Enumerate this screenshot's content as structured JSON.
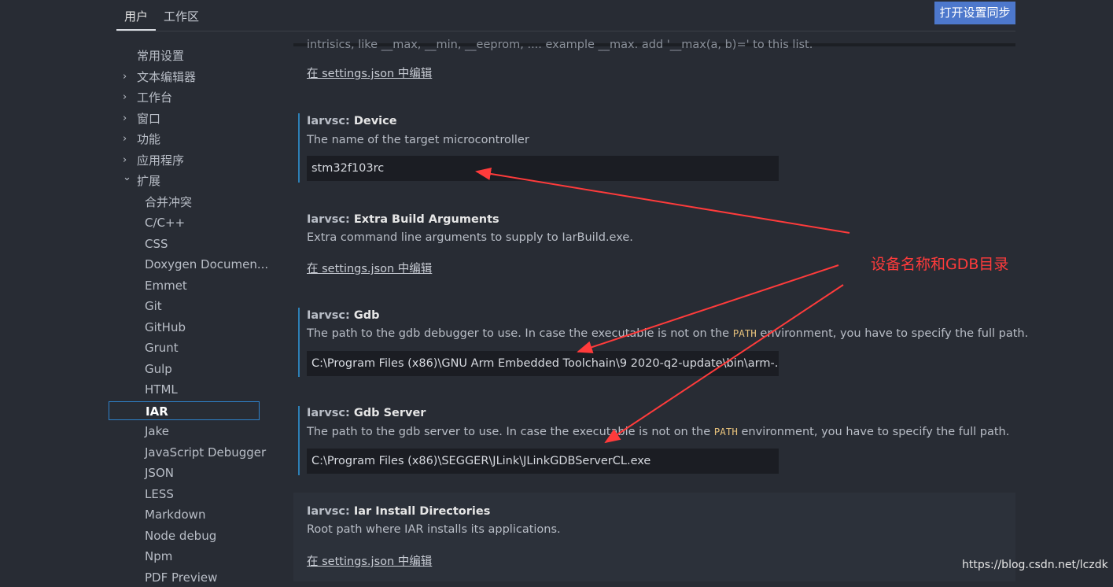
{
  "tabs": [
    {
      "label": "用户",
      "active": true
    },
    {
      "label": "工作区",
      "active": false
    }
  ],
  "sync_button": "打开设置同步",
  "sidebar": {
    "items": [
      {
        "label": "常用设置",
        "chevron": ""
      },
      {
        "label": "文本编辑器",
        "chevron": "›"
      },
      {
        "label": "工作台",
        "chevron": "›"
      },
      {
        "label": "窗口",
        "chevron": "›"
      },
      {
        "label": "功能",
        "chevron": "›"
      },
      {
        "label": "应用程序",
        "chevron": "›"
      },
      {
        "label": "扩展",
        "chevron": "⌄"
      },
      {
        "label": "合并冲突",
        "chevron": ""
      },
      {
        "label": "C/C++",
        "chevron": ""
      },
      {
        "label": "CSS",
        "chevron": ""
      },
      {
        "label": "Doxygen Documen...",
        "chevron": ""
      },
      {
        "label": "Emmet",
        "chevron": ""
      },
      {
        "label": "Git",
        "chevron": ""
      },
      {
        "label": "GitHub",
        "chevron": ""
      },
      {
        "label": "Grunt",
        "chevron": ""
      },
      {
        "label": "Gulp",
        "chevron": ""
      },
      {
        "label": "HTML",
        "chevron": ""
      },
      {
        "label": "IAR",
        "chevron": "",
        "selected": true
      },
      {
        "label": "Jake",
        "chevron": ""
      },
      {
        "label": "JavaScript Debugger",
        "chevron": ""
      },
      {
        "label": "JSON",
        "chevron": ""
      },
      {
        "label": "LESS",
        "chevron": ""
      },
      {
        "label": "Markdown",
        "chevron": ""
      },
      {
        "label": "Node debug",
        "chevron": ""
      },
      {
        "label": "Npm",
        "chevron": ""
      },
      {
        "label": "PDF Preview",
        "chevron": ""
      }
    ]
  },
  "top_partial": {
    "desc": "intrisics, like __max, __min, __eeprom, .... example __max. add '__max(a, b)=' to this list.",
    "link": "在 settings.json 中编辑"
  },
  "settings": {
    "device": {
      "category": "Iarvsc: ",
      "name": "Device",
      "desc": "The name of the target microcontroller",
      "value": "stm32f103rc"
    },
    "extra_build": {
      "category": "Iarvsc: ",
      "name": "Extra Build Arguments",
      "desc": "Extra command line arguments to supply to IarBuild.exe.",
      "link": "在 settings.json 中编辑"
    },
    "gdb": {
      "category": "Iarvsc: ",
      "name": "Gdb",
      "desc_pre": "The path to the gdb debugger to use. In case the executable is not on the ",
      "desc_code": "PATH",
      "desc_post": " environment, you have to specify the full path.",
      "value": "C:\\Program Files (x86)\\GNU Arm Embedded Toolchain\\9 2020-q2-update\\bin\\arm-..."
    },
    "gdb_server": {
      "category": "Iarvsc: ",
      "name": "Gdb Server",
      "desc_pre": "The path to the gdb server to use. In case the executable is not on the ",
      "desc_code": "PATH",
      "desc_post": " environment, you have to specify the full path.",
      "value": "C:\\Program Files (x86)\\SEGGER\\JLink\\JLinkGDBServerCL.exe"
    },
    "install_dirs": {
      "category": "Iarvsc: ",
      "name": "Iar Install Directories",
      "desc": "Root path where IAR installs its applications.",
      "link": "在 settings.json 中编辑"
    }
  },
  "annotation": "设备名称和GDB目录",
  "watermark": "https://blog.csdn.net/lczdk",
  "colors": {
    "background": "#282c34",
    "accent": "#4d78cc",
    "annotation": "#ff3b3b",
    "modified_bar": "#2d7fb5"
  }
}
